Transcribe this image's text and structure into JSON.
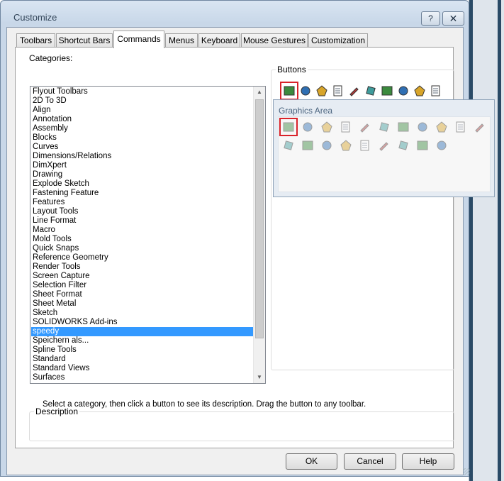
{
  "window": {
    "title": "Customize",
    "help_label": "?",
    "close_label": "✕"
  },
  "tabs": [
    {
      "label": "Toolbars"
    },
    {
      "label": "Shortcut Bars"
    },
    {
      "label": "Commands",
      "active": true
    },
    {
      "label": "Menus"
    },
    {
      "label": "Keyboard"
    },
    {
      "label": "Mouse Gestures"
    },
    {
      "label": "Customization"
    }
  ],
  "categories": {
    "label": "Categories:",
    "selected": "speedy",
    "items": [
      "Flyout Toolbars",
      "2D To 3D",
      "Align",
      "Annotation",
      "Assembly",
      "Blocks",
      "Curves",
      "Dimensions/Relations",
      "DimXpert",
      "Drawing",
      "Explode Sketch",
      "Fastening Feature",
      "Features",
      "Layout Tools",
      "Line Format",
      "Macro",
      "Mold Tools",
      "Quick Snaps",
      "Reference Geometry",
      "Render Tools",
      "Screen Capture",
      "Selection Filter",
      "Sheet Format",
      "Sheet Metal",
      "Sketch",
      "SOLIDWORKS Add-ins",
      "speedy",
      "Speichern als...",
      "Spline Tools",
      "Standard",
      "Standard Views",
      "Surfaces"
    ]
  },
  "buttons_group": {
    "label": "Buttons",
    "icons": [
      "speedy-tool-icon",
      "layer-list-icon",
      "green-cube-icon",
      "save-icon",
      "checklist-icon",
      "pencil-note-icon",
      "edit-document-icon",
      "hierarchy-icon",
      "properties-window-icon",
      "zoom-search-icon",
      "translate-icon",
      "text-document-icon",
      "print-icon",
      "print-preview-icon",
      "yellow-block-icon",
      "yellow-gear-icon",
      "shield-camera-icon",
      "info-icon"
    ]
  },
  "graphics_area": {
    "title": "Graphics Area",
    "icons": [
      "open-folder-icon",
      "hammer-icon",
      "document-gear-icon",
      "hand-part-icon",
      "line-icon",
      "eye-icon",
      "sort-icon",
      "paperclip-icon",
      "clip-chain-icon",
      "list-icon",
      "cube-link-icon",
      "sphere-icon",
      "split-sphere-icon",
      "copy-icon",
      "corner-icon",
      "magnifier-icon",
      "view-box-icon",
      "axis-icon",
      "cube-view-icon",
      "small-cube-icon"
    ]
  },
  "hint": "Select a category, then click a button to see its description. Drag the button to any toolbar.",
  "description": {
    "label": "Description",
    "text": ""
  },
  "footer": {
    "ok": "OK",
    "cancel": "Cancel",
    "help": "Help"
  }
}
